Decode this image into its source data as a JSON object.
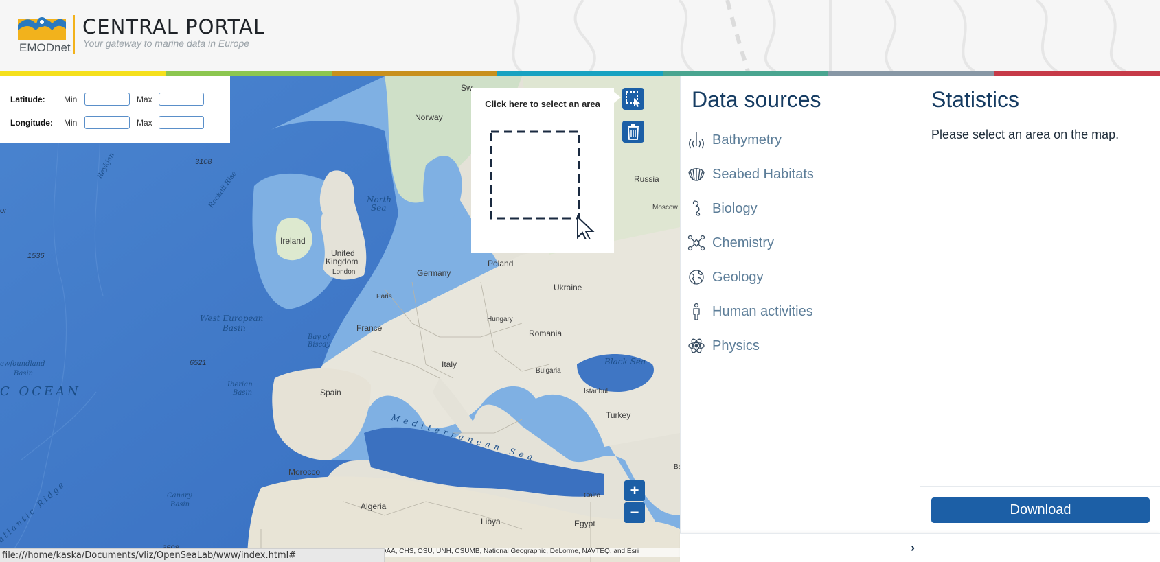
{
  "header": {
    "logo_text": "EMODnet",
    "title": "CENTRAL PORTAL",
    "subtitle": "Your gateway to marine data in Europe"
  },
  "colors": {
    "stripes": [
      "#f5e01d",
      "#8cc64f",
      "#c8901d",
      "#17a2c1",
      "#4aa590",
      "#8797a5",
      "#c63a48"
    ],
    "accent": "#1c5fa6",
    "heading": "#163c62",
    "link": "#5c7d98"
  },
  "coords": {
    "latitude_label": "Latitude:",
    "longitude_label": "Longitude:",
    "min_label": "Min",
    "max_label": "Max",
    "lat_min": "",
    "lat_max": "",
    "lon_min": "",
    "lon_max": ""
  },
  "map": {
    "select_hint": "Click here to select an area",
    "select_tool_icon": "select-area-icon",
    "delete_tool_icon": "trash-icon",
    "zoom_in": "+",
    "zoom_out": "−",
    "labels": {
      "norway": "Norway",
      "russia": "Russia",
      "moscow": "Moscow",
      "ireland": "Ireland",
      "uk1": "United",
      "uk2": "Kingdom",
      "london": "London",
      "north_sea1": "North",
      "north_sea2": "Sea",
      "germany": "Germany",
      "poland": "Poland",
      "ukraine": "Ukraine",
      "paris": "Paris",
      "france": "France",
      "hungary": "Hungary",
      "romania": "Romania",
      "bulgaria": "Bulgaria",
      "black_sea": "Black Sea",
      "istanbul": "Istanbul",
      "turkey": "Turkey",
      "italy": "Italy",
      "spain": "Spain",
      "bay1": "Bay of",
      "bay2": "Biscay",
      "west_eu1": "West European",
      "west_eu2": "Basin",
      "iberian1": "Iberian",
      "iberian2": "Basin",
      "newf1": "ewfoundland",
      "newf2": "Basin",
      "ocean": "C OCEAN",
      "mediterranean": "Mediterranean Sea",
      "morocco": "Morocco",
      "algeria": "Algeria",
      "libya": "Libya",
      "egypt": "Egypt",
      "cairo": "Cairo",
      "canary1": "Canary",
      "canary2": "Basin",
      "ridge": "atlantic Ridge",
      "rockall": "Rockall Rise",
      "reykj": "Reykjan",
      "d3108": "3108",
      "d1536": "1536",
      "d6521": "6521",
      "d3508": "3508",
      "ba": "Ba",
      "or": "or",
      "sw": "Sw"
    },
    "attribution": "Leaflet | Tiles © Esri — Sources: GEBCO, NOAA, CHS, OSU, UNH, CSUMB, National Geographic, DeLorme, NAVTEQ, and Esri"
  },
  "status_url": "file:///home/kaska/Documents/vliz/OpenSeaLab/www/index.html#",
  "data_sources": {
    "title": "Data sources",
    "items": [
      {
        "label": "Bathymetry",
        "icon": "bathymetry-icon"
      },
      {
        "label": "Seabed Habitats",
        "icon": "shell-icon"
      },
      {
        "label": "Biology",
        "icon": "seahorse-icon"
      },
      {
        "label": "Chemistry",
        "icon": "molecule-icon"
      },
      {
        "label": "Geology",
        "icon": "globe-icon"
      },
      {
        "label": "Human activities",
        "icon": "person-icon"
      },
      {
        "label": "Physics",
        "icon": "atom-icon"
      }
    ]
  },
  "statistics": {
    "title": "Statistics",
    "message": "Please select an area on the map.",
    "download_label": "Download"
  }
}
